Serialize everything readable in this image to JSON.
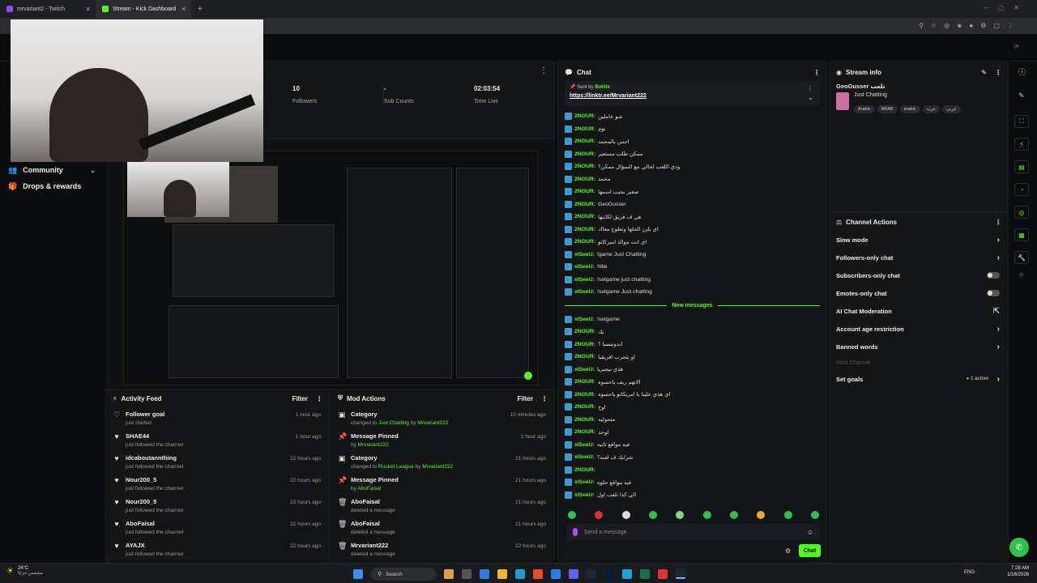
{
  "browser": {
    "tabs": [
      {
        "label": "mrvariant2 - Twitch",
        "active": false
      },
      {
        "label": "Stream - Kick Dashboard",
        "active": true
      }
    ]
  },
  "nav": {
    "items": [
      {
        "label": "Community"
      },
      {
        "label": "Drops & rewards"
      }
    ]
  },
  "stats": [
    {
      "value": "10",
      "label": "Followers"
    },
    {
      "value": "-",
      "label": "Sub Counts"
    },
    {
      "value": "02:03:54",
      "label": "Time Live"
    }
  ],
  "activity_feed": {
    "title": "Activity Feed",
    "filter_label": "Filter",
    "items": [
      {
        "name": "Follower goal",
        "desc": "just started",
        "time": "1 hour ago"
      },
      {
        "name": "SHAE44",
        "desc": "just followed the channel",
        "time": "1 hour ago"
      },
      {
        "name": "idcaboutannthing",
        "desc": "just followed the channel",
        "time": "22 hours ago"
      },
      {
        "name": "Nour200_5",
        "desc": "just followed the channel",
        "time": "22 hours ago"
      },
      {
        "name": "Nour200_5",
        "desc": "just followed the channel",
        "time": "22 hours ago"
      },
      {
        "name": "AboFaisal",
        "desc": "just followed the channel",
        "time": "22 hours ago"
      },
      {
        "name": "AYAJX",
        "desc": "just followed the channel",
        "time": "22 hours ago"
      }
    ]
  },
  "mod_actions": {
    "title": "Mod Actions",
    "filter_label": "Filter",
    "items": [
      {
        "name": "Category",
        "desc": "changed to ",
        "highlight": "Just Chatting",
        "by": " by ",
        "user": "Mrvariant222",
        "time": "10 minutes ago",
        "icon": "▣"
      },
      {
        "name": "Message Pinned",
        "desc": "by ",
        "highlight": "Mrvariant222",
        "by": "",
        "user": "",
        "time": "1 hour ago",
        "icon": "📌"
      },
      {
        "name": "Category",
        "desc": "changed to ",
        "highlight": "Rocket League",
        "by": " by ",
        "user": "Mrvariant222",
        "time": "21 hours ago",
        "icon": "▣"
      },
      {
        "name": "Message Pinned",
        "desc": "by ",
        "highlight": "AboFaisal",
        "by": "",
        "user": "",
        "time": "21 hours ago",
        "icon": "📌"
      },
      {
        "name": "AboFaisal",
        "desc": "deleted a message",
        "highlight": "",
        "by": "",
        "user": "",
        "time": "21 hours ago",
        "icon": "🗑"
      },
      {
        "name": "AboFaisal",
        "desc": "deleted a message",
        "highlight": "",
        "by": "",
        "user": "",
        "time": "21 hours ago",
        "icon": "🗑"
      },
      {
        "name": "Mrvariant222",
        "desc": "deleted a message",
        "highlight": "",
        "by": "",
        "user": "",
        "time": "22 hours ago",
        "icon": "🗑"
      }
    ]
  },
  "chat": {
    "title": "Chat",
    "pinned": {
      "sent_by_label": "Sent by",
      "sender": "Botlitx",
      "link": "https://linktr.ee/Mrvariant222"
    },
    "messages_before": [
      {
        "user": "2NOUR:",
        "text": "شو عاملين"
      },
      {
        "user": "2NOUR:",
        "text": "نوم"
      },
      {
        "user": "2NOUR:",
        "text": "احس بالمحمد"
      },
      {
        "user": "2NOUR:",
        "text": "ممكن طلب مستعير"
      },
      {
        "user": "2NOUR:",
        "text": "ودي اللعب لحالي مع السؤال ممكن؟"
      },
      {
        "user": "2NOUR:",
        "text": "محمد"
      },
      {
        "user": "2NOUR:",
        "text": "صعير بجيب اسمها"
      },
      {
        "user": "2NOUR:",
        "text": "GeoGusser"
      },
      {
        "user": "2NOUR:",
        "text": "هي ف فريق لكابتها"
      },
      {
        "user": "2NOUR:",
        "text": "اي بلزر الحلها وتطوع معاك"
      },
      {
        "user": "2NOUR:",
        "text": "اي انت موالد اميركانو"
      },
      {
        "user": "xISeeU:",
        "text": "!game Just Chatting"
      },
      {
        "user": "xISeeU:",
        "text": "!title"
      },
      {
        "user": "xISeeU:",
        "text": "!setgame just chatting"
      },
      {
        "user": "xISeeU:",
        "text": "!setgame Just chatting"
      }
    ],
    "divider_label": "New messages",
    "messages_after": [
      {
        "user": "xISeeU:",
        "text": "!setgame"
      },
      {
        "user": "2NOUR:",
        "text": "بك"
      },
      {
        "user": "2NOUR:",
        "text": "اندونيسيا ؟"
      },
      {
        "user": "2NOUR:",
        "text": "او بتجرب افريقيا"
      },
      {
        "user": "xISeeU:",
        "text": "هذي نيجيريا"
      },
      {
        "user": "2NOUR:",
        "text": "الاتهم ريف ياحسوه"
      },
      {
        "user": "2NOUR:",
        "text": "اي هذي علينا يا امريكانو ياحسوه"
      },
      {
        "user": "2NOUR:",
        "text": "اوح"
      },
      {
        "user": "2NOUR:",
        "text": "متحوليه"
      },
      {
        "user": "2NOUR:",
        "text": "لوحد"
      },
      {
        "user": "xISeeU:",
        "text": "فيه مواقع ثانيه"
      },
      {
        "user": "xISeeU:",
        "text": "شرايك ف لعبه؟"
      },
      {
        "user": "2NOUR:",
        "text": ""
      },
      {
        "user": "xISeeU:",
        "text": "فيه مواقع حلوه"
      },
      {
        "user": "xISeeU:",
        "text": "الي كذا تلعب اول"
      }
    ],
    "input_placeholder": "Send a message",
    "send_label": "Chat"
  },
  "stream_info": {
    "title": "Stream info",
    "stream_title": "GeoGusser تلعب",
    "category": "Just Chatting",
    "tags": [
      "Arabic",
      "ARAB",
      "arabic",
      "عرب",
      "عربي"
    ]
  },
  "channel_actions": {
    "title": "Channel Actions",
    "items": [
      {
        "label": "Slow mode",
        "kind": "chevron"
      },
      {
        "label": "Followers-only chat",
        "kind": "chevron"
      },
      {
        "label": "Subscribers-only chat",
        "kind": "toggle"
      },
      {
        "label": "Emotes-only chat",
        "kind": "toggle"
      },
      {
        "label": "AI Chat Moderation",
        "kind": "external"
      },
      {
        "label": "Account age restriction",
        "kind": "chevron"
      },
      {
        "label": "Banned words",
        "kind": "chevron"
      }
    ],
    "host_channel_label": "Host Channel",
    "set_goals_label": "Set goals",
    "set_goals_status": "1 active"
  },
  "taskbar": {
    "weather_temp": "24°C",
    "weather_desc": "مشمس جزئيًا",
    "search_label": "Search",
    "lang": "ENG",
    "time": "7:28 AM",
    "date": "1/16/2026"
  },
  "colors": {
    "accent": "#53fc18",
    "panel": "#141517",
    "bg": "#0b0c0d"
  }
}
